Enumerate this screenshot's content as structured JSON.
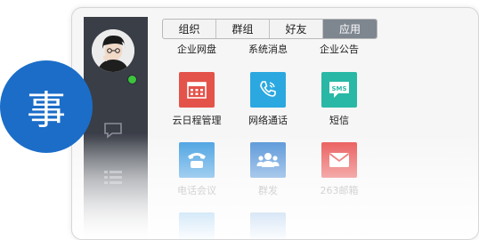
{
  "tabs": [
    {
      "label": "组织",
      "active": false
    },
    {
      "label": "群组",
      "active": false
    },
    {
      "label": "好友",
      "active": false
    },
    {
      "label": "应用",
      "active": true
    }
  ],
  "top_labels": [
    "企业网盘",
    "系统消息",
    "企业公告"
  ],
  "apps": [
    {
      "label": "云日程管理",
      "icon": "calendar-icon",
      "color": "#e4534a"
    },
    {
      "label": "网络通话",
      "icon": "phone-icon",
      "color": "#2ba8e0"
    },
    {
      "label": "短信",
      "icon": "sms-icon",
      "color": "#29b8a5"
    },
    {
      "label": "电话会议",
      "icon": "conference-phone-icon",
      "color": "#3d9be0"
    },
    {
      "label": "群发",
      "icon": "group-icon",
      "color": "#4d8fd6"
    },
    {
      "label": "263邮箱",
      "icon": "mail-icon",
      "color": "#e8504f"
    }
  ],
  "badge": {
    "text": "事",
    "color": "#1b6dc8"
  },
  "status": {
    "online_color": "#3cc43c"
  }
}
